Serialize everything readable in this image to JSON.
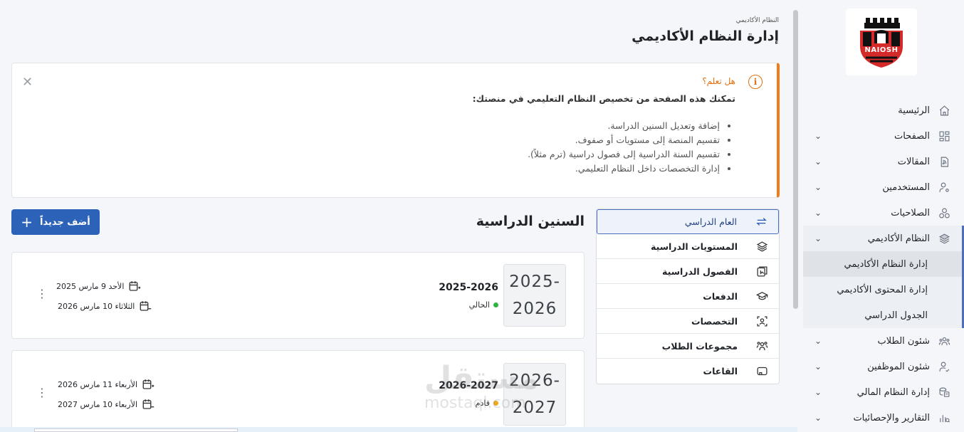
{
  "sidebar": {
    "logo_text": "NAIOSH",
    "items": [
      {
        "label": "الرئيسية",
        "icon": "home-icon",
        "has_children": false
      },
      {
        "label": "الصفحات",
        "icon": "pages-icon",
        "has_children": true
      },
      {
        "label": "المقالات",
        "icon": "articles-icon",
        "has_children": true
      },
      {
        "label": "المستخدمين",
        "icon": "user-settings-icon",
        "has_children": true
      },
      {
        "label": "الصلاحيات",
        "icon": "permissions-icon",
        "has_children": true
      },
      {
        "label": "النظام الأكاديمي",
        "icon": "layers-icon",
        "has_children": true,
        "open": true
      },
      {
        "label": "شئون الطلاب",
        "icon": "students-icon",
        "has_children": true
      },
      {
        "label": "شئون الموظفين",
        "icon": "employees-icon",
        "has_children": true
      },
      {
        "label": "إدارة النظام المالي",
        "icon": "finance-icon",
        "has_children": true
      },
      {
        "label": "التقارير والإحصائيات",
        "icon": "reports-icon",
        "has_children": true
      }
    ],
    "academic_sub": [
      {
        "label": "إدارة النظام الأكاديمي",
        "active": true
      },
      {
        "label": "إدارة المحتوى الأكاديمي",
        "active": false
      },
      {
        "label": "الجدول الدراسي",
        "active": false
      }
    ]
  },
  "header": {
    "breadcrumb": "النظام الأكاديمي",
    "title": "إدارة النظام الأكاديمي"
  },
  "alert": {
    "title": "هل تعلم؟",
    "description": "تمكنك هذه الصفحة من تخصيص النظام التعليمي في منصتك:",
    "points": [
      "إضافة وتعديل السنين الدراسة.",
      "تقسيم المنصة إلى مستويات أو صفوف.",
      "تقسيم السنة الدراسية إلى فصول دراسية (ترم مثلاً).",
      "إدارة التخصصات داخل النظام التعليمي."
    ]
  },
  "tabs": [
    {
      "label": "العام الدراسي",
      "icon": "swap-icon",
      "active": true
    },
    {
      "label": "المستويات الدراسية",
      "icon": "stack-icon",
      "active": false
    },
    {
      "label": "الفصول الدراسية",
      "icon": "terms-icon",
      "active": false
    },
    {
      "label": "الدفعات",
      "icon": "graduation-cap-icon",
      "active": false
    },
    {
      "label": "التخصصات",
      "icon": "specialization-icon",
      "active": false
    },
    {
      "label": "مجموعات الطلاب",
      "icon": "group-icon",
      "active": false
    },
    {
      "label": "القاعات",
      "icon": "hall-icon",
      "active": false
    }
  ],
  "section": {
    "title": "السنين الدراسية",
    "add_label": "أضف جديداً"
  },
  "years": [
    {
      "badge_top": "2025-",
      "badge_bottom": "2026",
      "name": "2025-2026",
      "status": "الحالي",
      "status_color": "#2fb344",
      "start_date": "الأحد 9 مارس 2025",
      "end_date": "الثلاثاء 10 مارس 2026"
    },
    {
      "badge_top": "2026-",
      "badge_bottom": "2027",
      "name": "2026-2027",
      "status": "قادم",
      "status_color": "#f0a81a",
      "start_date": "الأربعاء 11 مارس 2026",
      "end_date": "الأربعاء 10 مارس 2027"
    }
  ],
  "watermark": {
    "arabic": "مستقل",
    "latin": "mostaql.com"
  },
  "colors": {
    "primary": "#2c63b8",
    "alert_accent": "#f07c1a",
    "sidebar_active_border": "#4a6fc0"
  }
}
